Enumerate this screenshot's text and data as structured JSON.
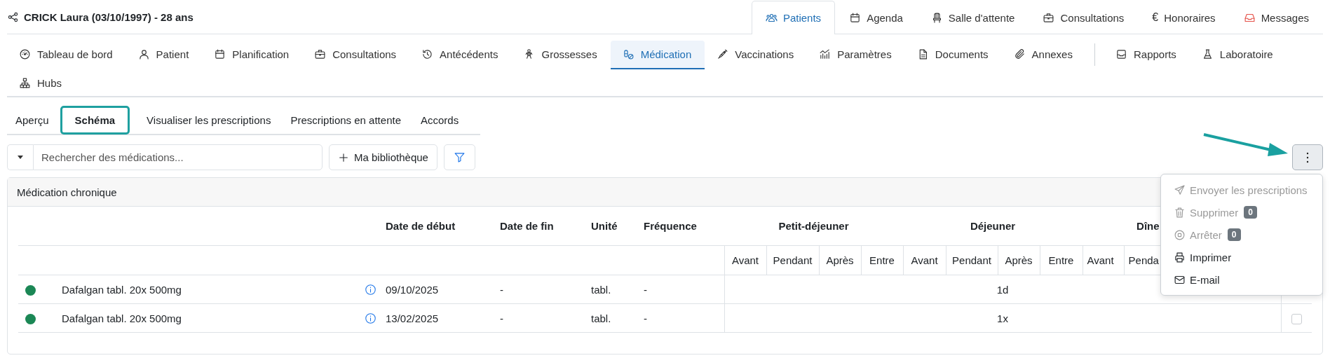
{
  "header": {
    "title": "CRICK Laura (03/10/1997) - 28 ans"
  },
  "top_tabs": [
    {
      "label": "Patients",
      "selected": true
    },
    {
      "label": "Agenda",
      "selected": false
    },
    {
      "label": "Salle d'attente",
      "selected": false
    },
    {
      "label": "Consultations",
      "selected": false
    },
    {
      "label": "Honoraires",
      "icon_text": "€",
      "selected": false
    },
    {
      "label": "Messages",
      "selected": false
    }
  ],
  "module_tab_groups": [
    {
      "items": [
        {
          "label": "Tableau de bord",
          "selected": false
        },
        {
          "label": "Patient",
          "selected": false
        },
        {
          "label": "Planification",
          "selected": false
        },
        {
          "label": "Consultations",
          "selected": false
        },
        {
          "label": "Antécédents",
          "selected": false
        },
        {
          "label": "Grossesses",
          "selected": false
        },
        {
          "label": "Médication",
          "selected": true
        },
        {
          "label": "Vaccinations",
          "selected": false
        },
        {
          "label": "Paramètres",
          "selected": false
        },
        {
          "label": "Documents",
          "selected": false
        },
        {
          "label": "Annexes",
          "selected": false
        }
      ]
    },
    {
      "items": [
        {
          "label": "Rapports",
          "selected": false
        },
        {
          "label": "Laboratoire",
          "selected": false
        },
        {
          "label": "Hubs",
          "selected": false
        }
      ]
    }
  ],
  "sub_tabs": [
    {
      "label": "Aperçu",
      "selected": false
    },
    {
      "label": "Schéma",
      "selected": true
    },
    {
      "label": "Visualiser les prescriptions",
      "selected": false
    },
    {
      "label": "Prescriptions en attente",
      "selected": false
    },
    {
      "label": "Accords",
      "selected": false
    }
  ],
  "search": {
    "placeholder": "Rechercher des médications..."
  },
  "library_button": {
    "label": "Ma bibliothèque"
  },
  "card": {
    "title": "Médication chronique"
  },
  "table": {
    "columns": [
      "Date de début",
      "Date de fin",
      "Unité",
      "Fréquence"
    ],
    "groups": [
      {
        "label": "Petit-déjeuner",
        "subcolumns": [
          "Avant",
          "Pendant",
          "Après",
          "Entre"
        ]
      },
      {
        "label": "Déjeuner",
        "subcolumns": [
          "Avant",
          "Pendant",
          "Après",
          "Entre"
        ]
      },
      {
        "label": "Dîne",
        "subcolumns": [
          "Avant",
          "Penda"
        ]
      }
    ],
    "rows": [
      {
        "color": "#1b8755",
        "name": "Dafalgan tabl. 20x 500mg",
        "start": "09/10/2025",
        "end": "-",
        "unit": "tabl.",
        "frequency": "-",
        "schedule": "1d"
      },
      {
        "color": "#1b8755",
        "name": "Dafalgan tabl. 20x 500mg",
        "start": "13/02/2025",
        "end": "-",
        "unit": "tabl.",
        "frequency": "-",
        "schedule": "1x",
        "checked": false
      }
    ]
  },
  "menu": {
    "items": [
      {
        "label": "Envoyer les prescriptions",
        "disabled": true
      },
      {
        "label": "Supprimer",
        "badge": "0",
        "disabled": true
      },
      {
        "label": "Arrêter",
        "badge": "0",
        "disabled": true
      },
      {
        "label": "Imprimer",
        "disabled": false
      },
      {
        "label": "E-mail",
        "disabled": false
      }
    ]
  }
}
